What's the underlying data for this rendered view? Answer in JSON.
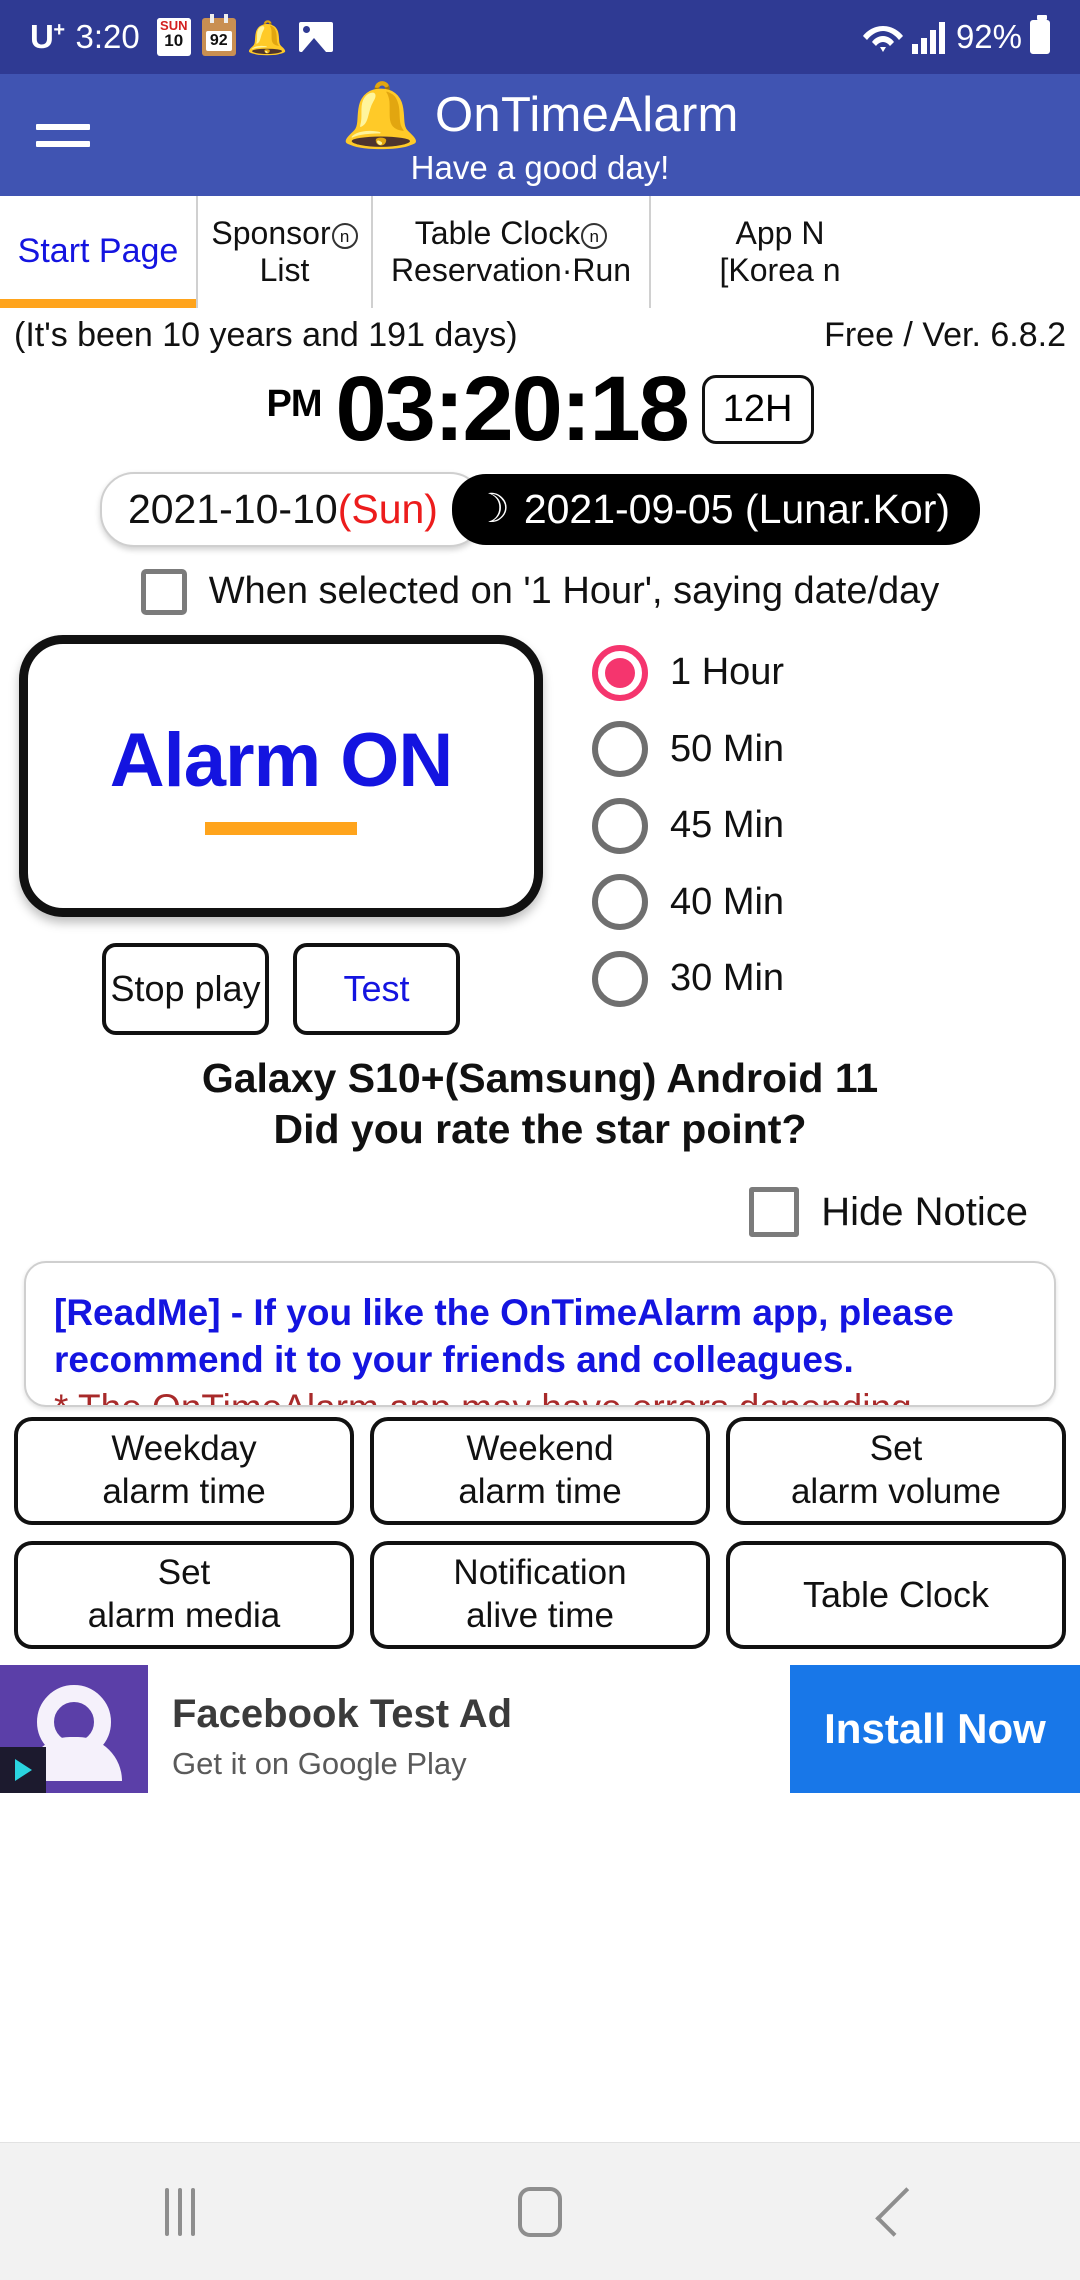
{
  "status_bar": {
    "carrier": "U",
    "carrier_sup": "+",
    "time": "3:20",
    "calendar_icon_top": "SUN",
    "calendar_icon_day": "10",
    "note_icon_value": "92",
    "battery_percent": "92%"
  },
  "app_bar": {
    "title": "OnTimeAlarm",
    "subtitle": "Have a good day!",
    "menu_icon": "hamburger-menu-icon",
    "bell_icon": "bell-icon"
  },
  "tabs": [
    {
      "line1": "Start Page",
      "line2": "",
      "superscript": "",
      "active": true
    },
    {
      "line1": "Sponsor",
      "line2": "List",
      "superscript": "n",
      "active": false
    },
    {
      "line1": "Table Clock",
      "line2": "Reservation·Run",
      "superscript": "n",
      "active": false
    },
    {
      "line1": "App N",
      "line2": "[Korea n",
      "superscript": "",
      "active": false
    }
  ],
  "info_row": {
    "elapsed": "(It's been 10 years and 191 days)",
    "version": "Free / Ver. 6.8.2"
  },
  "clock": {
    "ampm": "PM",
    "time": "03:20:18",
    "format_toggle": "12H"
  },
  "dates": {
    "solar_date": "2021-10-10",
    "solar_dow": "(Sun)",
    "moon_icon": "☽",
    "lunar_date": "2021-09-05 (Lunar.Kor)"
  },
  "hour_option_checkbox": {
    "label": "When selected on '1 Hour', saying date/day",
    "checked": false
  },
  "alarm": {
    "main_button_label": "Alarm ON",
    "stop_button_label": "Stop play",
    "test_button_label": "Test"
  },
  "interval_options": [
    {
      "label": "1 Hour",
      "selected": true
    },
    {
      "label": "50 Min",
      "selected": false
    },
    {
      "label": "45 Min",
      "selected": false
    },
    {
      "label": "40 Min",
      "selected": false
    },
    {
      "label": "30 Min",
      "selected": false
    }
  ],
  "device_info": {
    "line1": "Galaxy S10+(Samsung) Android 11",
    "line2": "Did you rate the star point?"
  },
  "hide_notice": {
    "label": "Hide Notice",
    "checked": false
  },
  "notice": {
    "line1": "[ReadMe] - If you like the OnTimeAlarm app, please",
    "line2": "recommend it to your friends and colleagues.",
    "line3": "* The OnTimeAlarm app may have errors depending"
  },
  "grid_buttons": [
    {
      "line1": "Weekday",
      "line2": "alarm time"
    },
    {
      "line1": "Weekend",
      "line2": "alarm time"
    },
    {
      "line1": "Set",
      "line2": "alarm volume"
    },
    {
      "line1": "Set",
      "line2": "alarm media"
    },
    {
      "line1": "Notification",
      "line2": "alive time"
    },
    {
      "line1": "Table Clock",
      "line2": ""
    }
  ],
  "ad": {
    "title": "Facebook Test Ad",
    "subtitle": "Get it on Google Play",
    "cta": "Install Now"
  },
  "nav_bar": {
    "recents": "recents-icon",
    "home": "home-icon",
    "back": "back-icon"
  },
  "colors": {
    "status_bar": "#2f3a93",
    "app_bar": "#4054b2",
    "accent_orange": "#ffa41c",
    "link_blue": "#1414e0",
    "radio_selected": "#f5356e",
    "notice_red": "#a82a2a",
    "ad_cta_blue": "#1877e8"
  }
}
